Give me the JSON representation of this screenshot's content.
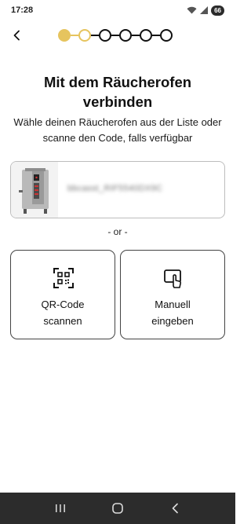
{
  "status_bar": {
    "time": "17:28",
    "battery_label": "66",
    "icons": [
      "wifi-icon",
      "signal-icon",
      "battery-icon"
    ]
  },
  "header": {
    "back_icon": "chevron-left-icon",
    "stepper": {
      "total_steps": 6,
      "completed_steps": 1,
      "current_step": 2
    }
  },
  "main": {
    "title": "Mit dem Räucherofen verbinden",
    "subtitle": "Wähle deinen Räucherofen aus der Liste oder scanne den Code, falls verfügbar",
    "device": {
      "name": "bbcasst_RIF5540DX9C",
      "image_icon": "smoker-device-image"
    },
    "or_label": "- or -",
    "options": [
      {
        "label_line1": "QR-Code",
        "label_line2": "scannen",
        "icon": "qr-code-scan-icon"
      },
      {
        "label_line1": "Manuell",
        "label_line2": "eingeben",
        "icon": "tap-screen-icon"
      }
    ]
  },
  "nav_bar": {
    "icons": [
      "recent-apps-icon",
      "home-icon",
      "back-icon"
    ]
  },
  "colors": {
    "accent": "#e6c45e",
    "text": "#111111",
    "card_border": "#444444",
    "nav_bar": "#2c2c2c"
  }
}
